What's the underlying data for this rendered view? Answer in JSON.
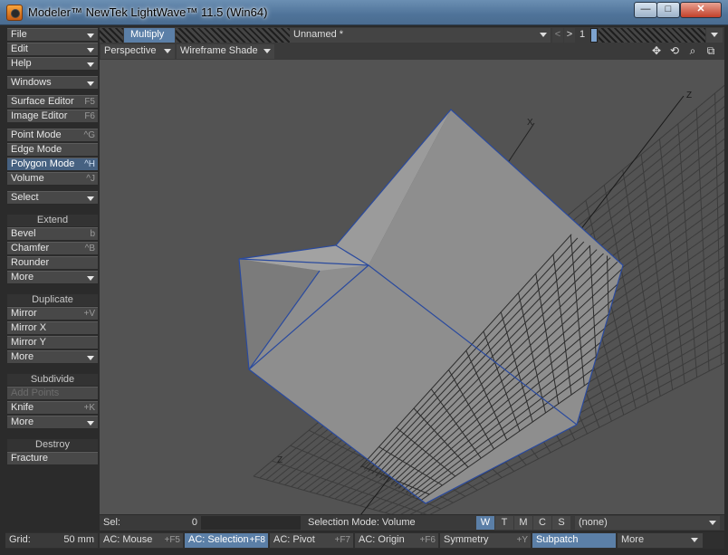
{
  "window": {
    "title": "Modeler™ NewTek LightWave™ 11.5 (Win64)",
    "minimize": "—",
    "maximize": "□",
    "close": "✕"
  },
  "sidebar": {
    "menus": [
      {
        "label": "File"
      },
      {
        "label": "Edit"
      },
      {
        "label": "Help"
      }
    ],
    "windows": {
      "label": "Windows"
    },
    "editors": [
      {
        "label": "Surface Editor",
        "shortcut": "F5"
      },
      {
        "label": "Image Editor",
        "shortcut": "F6"
      }
    ],
    "modes": [
      {
        "label": "Point Mode",
        "shortcut": "^G"
      },
      {
        "label": "Edge Mode",
        "shortcut": ""
      },
      {
        "label": "Polygon Mode",
        "shortcut": "^H"
      },
      {
        "label": "Volume",
        "shortcut": "^J"
      }
    ],
    "select": {
      "label": "Select"
    },
    "extend": {
      "heading": "Extend",
      "items": [
        {
          "label": "Bevel",
          "shortcut": "b"
        },
        {
          "label": "Chamfer",
          "shortcut": "^B"
        },
        {
          "label": "Rounder",
          "shortcut": ""
        },
        {
          "label": "More",
          "shortcut": ""
        }
      ]
    },
    "duplicate": {
      "heading": "Duplicate",
      "items": [
        {
          "label": "Mirror",
          "shortcut": "+V"
        },
        {
          "label": "Mirror X",
          "shortcut": ""
        },
        {
          "label": "Mirror Y",
          "shortcut": ""
        },
        {
          "label": "More",
          "shortcut": ""
        }
      ]
    },
    "subdivide": {
      "heading": "Subdivide",
      "items": [
        {
          "label": "Add Points",
          "shortcut": ""
        },
        {
          "label": "Knife",
          "shortcut": "+K"
        },
        {
          "label": "More",
          "shortcut": ""
        }
      ]
    },
    "destroy": {
      "heading": "Destroy",
      "items": [
        {
          "label": "Fracture",
          "shortcut": ""
        }
      ]
    }
  },
  "toolbar": {
    "active_tab": "Multiply",
    "object_name": "Unnamed *",
    "layer_prev": "<",
    "layer_next": ">",
    "layer_number": "1"
  },
  "viewport": {
    "view": "Perspective",
    "shading": "Wireframe Shade",
    "icons": [
      "move-icon",
      "rotate-icon",
      "zoom-icon",
      "maximize-icon"
    ],
    "axis_labels": {
      "z": "Z",
      "z_low": "Z",
      "x": "X"
    }
  },
  "infobar": {
    "sel_label": "Sel:",
    "sel_count": "0",
    "selection_mode": "Selection Mode:  Volume",
    "wtmcs": [
      "W",
      "T",
      "M",
      "C",
      "S"
    ],
    "active_wtmcs": "W",
    "vmap": "(none)"
  },
  "bottombar": {
    "grid_label": "Grid:",
    "grid_value": "50 mm",
    "items": [
      {
        "label": "AC: Mouse",
        "shortcut": "+F5"
      },
      {
        "label": "AC: Selection",
        "shortcut": "+F8"
      },
      {
        "label": "AC: Pivot",
        "shortcut": "+F7"
      },
      {
        "label": "AC: Origin",
        "shortcut": "+F6"
      },
      {
        "label": "Symmetry",
        "shortcut": "+Y"
      },
      {
        "label": "Subpatch",
        "shortcut": ""
      },
      {
        "label": "More",
        "shortcut": ""
      }
    ]
  },
  "colors": {
    "accent": "#5b7fa7",
    "selected": "#466181",
    "viewport_bg": "#535353",
    "mesh_face": "#8f8f8f",
    "mesh_edge": "#2f4f9a",
    "grid": "#3a3a3a"
  }
}
